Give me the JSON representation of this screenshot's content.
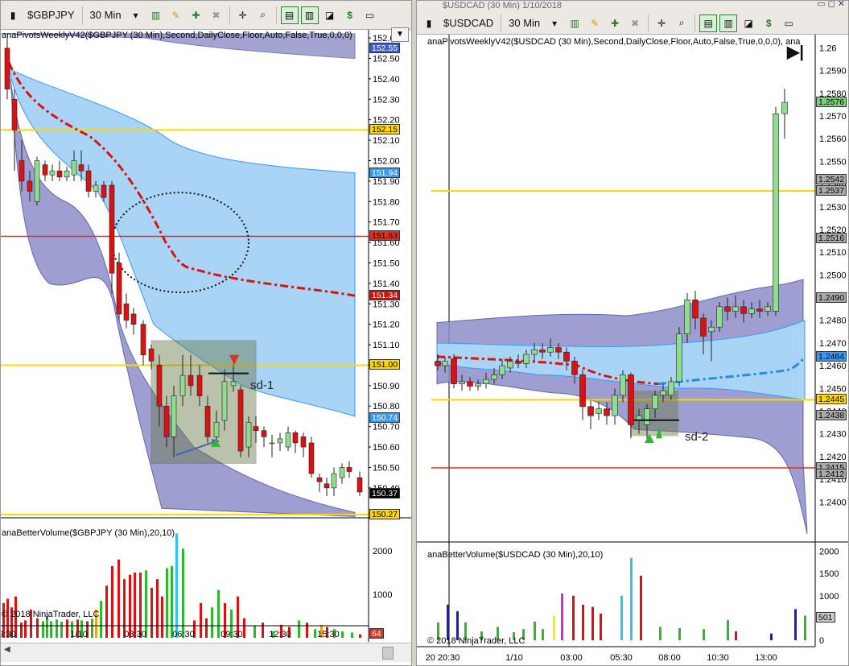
{
  "left": {
    "symbol": "$GBPJPY",
    "interval": "30 Min",
    "indicator_main": "anaPivotsWeeklyV42($GBPJPY (30 Min),Second,DailyClose,Floor,Auto,False,True,0,0,0)",
    "indicator_vol": "anaBetterVolume($GBPJPY (30 Min),20,10)",
    "copyright": "© 2018 NinjaTrader, LLC",
    "annotation": "sd-1",
    "price_ticks": [
      "152.6",
      "152.50",
      "152.40",
      "152.30",
      "152.20",
      "152.10",
      "152.00",
      "151.90",
      "151.80",
      "151.70",
      "151.60",
      "151.50",
      "151.40",
      "151.30",
      "151.20",
      "151.10",
      "151.00",
      "150.90",
      "150.80",
      "150.70",
      "150.60",
      "150.50",
      "150.40"
    ],
    "price_tags": [
      {
        "label": "152.55",
        "bg": "#3a5fcd",
        "fg": "#ffffff"
      },
      {
        "label": "152.15",
        "bg": "#ffd800",
        "fg": "#000000"
      },
      {
        "label": "151.94",
        "bg": "#3399ff",
        "fg": "#ffffff"
      },
      {
        "label": "151.63",
        "bg": "#e03020",
        "fg": "#000000"
      },
      {
        "label": "151.34",
        "bg": "#cc1111",
        "fg": "#ffffff"
      },
      {
        "label": "151.00",
        "bg": "#ffd800",
        "fg": "#000000"
      },
      {
        "label": "150.74",
        "bg": "#3399ff",
        "fg": "#ffffff"
      },
      {
        "label": "150.37",
        "bg": "#000000",
        "fg": "#ffffff"
      },
      {
        "label": "150.27",
        "bg": "#ffd800",
        "fg": "#000000"
      }
    ],
    "vol_ticks": [
      "2000",
      "1000"
    ],
    "vol_tag": {
      "label": "64",
      "bg": "#e03020",
      "fg": "#ffffff"
    },
    "time_ticks": [
      "9:30",
      "1/10",
      "03:30",
      "06:30",
      "09:30",
      "12:30",
      "15:30"
    ]
  },
  "right": {
    "title": "$USDCAD (30 Min)  1/10/2018",
    "symbol": "$USDCAD",
    "interval": "30 Min",
    "indicator_main": "anaPivotsWeeklyV42($USDCAD (30 Min),Second,DailyClose,Floor,Auto,False,True,0,0,0), ana",
    "indicator_vol": "anaBetterVolume($USDCAD (30 Min),20,10)",
    "copyright": "© 2018 NinjaTrader, LLC",
    "annotation": "sd-2",
    "price_ticks": [
      "1.26",
      "1.2590",
      "1.2580",
      "1.2570",
      "1.2560",
      "1.2550",
      "1.2540",
      "1.2530",
      "1.2520",
      "1.2510",
      "1.2500",
      "1.2490",
      "1.2480",
      "1.2470",
      "1.2460",
      "1.2450",
      "1.2440",
      "1.2430",
      "1.2420",
      "1.2410",
      "1.2400"
    ],
    "price_tags": [
      {
        "label": "1.2576",
        "bg": "#7ed07e",
        "fg": "#000000"
      },
      {
        "label": "1.2542",
        "bg": "#aaaaaa",
        "fg": "#000000"
      },
      {
        "label": "1.2537",
        "bg": "#aaaaaa",
        "fg": "#000000"
      },
      {
        "label": "1.2516",
        "bg": "#aaaaaa",
        "fg": "#000000"
      },
      {
        "label": "1.2490",
        "bg": "#aaaaaa",
        "fg": "#000000"
      },
      {
        "label": "1.2464",
        "bg": "#3399ff",
        "fg": "#000000"
      },
      {
        "label": "1.2445",
        "bg": "#ffd800",
        "fg": "#000000"
      },
      {
        "label": "1.2438",
        "bg": "#aaaaaa",
        "fg": "#000000"
      },
      {
        "label": "1.2415",
        "bg": "#aaaaaa",
        "fg": "#000000"
      },
      {
        "label": "1.2412",
        "bg": "#aaaaaa",
        "fg": "#000000"
      }
    ],
    "vol_ticks": [
      "2000",
      "1500",
      "1000",
      "500",
      "0"
    ],
    "vol_tag": {
      "label": "501",
      "bg": "#cccccc",
      "fg": "#000000"
    },
    "time_ticks": [
      "20 20:30",
      "1/10",
      "03:00",
      "05:30",
      "08:00",
      "10:30",
      "13:00"
    ]
  },
  "colors": {
    "bull": "#90dd90",
    "bear": "#dd1111",
    "pivot_red": "#dd1111",
    "band_blue": "#aad4f5",
    "band_purple": "#8e8ec8",
    "yellow": "#ffd800",
    "red_line": "#e03020"
  }
}
